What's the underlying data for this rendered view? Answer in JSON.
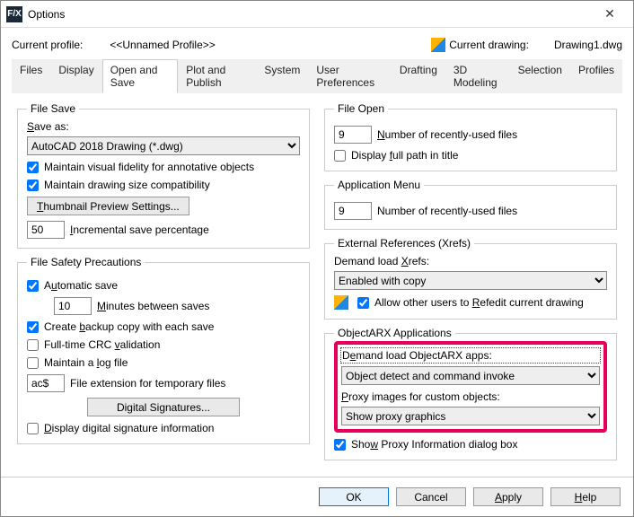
{
  "window": {
    "title": "Options"
  },
  "profile": {
    "label": "Current profile:",
    "value": "<<Unnamed Profile>>",
    "drawing_label": "Current drawing:",
    "drawing_value": "Drawing1.dwg"
  },
  "tabs": [
    "Files",
    "Display",
    "Open and Save",
    "Plot and Publish",
    "System",
    "User Preferences",
    "Drafting",
    "3D Modeling",
    "Selection",
    "Profiles"
  ],
  "active_tab": 2,
  "file_save": {
    "legend": "File Save",
    "save_as_label": "Save as:",
    "save_as_value": "AutoCAD 2018 Drawing (*.dwg)",
    "chk1": "Maintain visual fidelity for annotative objects",
    "chk2": "Maintain drawing size compatibility",
    "thumb_btn": "Thumbnail Preview Settings...",
    "inc_value": "50",
    "inc_label": "Incremental save percentage"
  },
  "safety": {
    "legend": "File Safety Precautions",
    "chk_auto": "Automatic save",
    "minutes_value": "10",
    "minutes_label": "Minutes between saves",
    "chk_backup": "Create backup copy with each save",
    "chk_crc": "Full-time CRC validation",
    "chk_log": "Maintain a log file",
    "ext_value": "ac$",
    "ext_label": "File extension for temporary files",
    "dig_btn": "Digital Signatures...",
    "chk_dsig": "Display digital signature information"
  },
  "file_open": {
    "legend": "File Open",
    "num_value": "9",
    "num_label": "Number of recently-used files",
    "chk_path": "Display full path in title"
  },
  "app_menu": {
    "legend": "Application Menu",
    "num_value": "9",
    "num_label": "Number of recently-used files"
  },
  "xrefs": {
    "legend": "External References (Xrefs)",
    "demand_label": "Demand load Xrefs:",
    "demand_value": "Enabled with copy",
    "chk_allow": "Allow other users to Refedit current drawing"
  },
  "arx": {
    "legend": "ObjectARX Applications",
    "demand_label": "Demand load ObjectARX apps:",
    "demand_value": "Object detect and command invoke",
    "proxy_label": "Proxy images for custom objects:",
    "proxy_value": "Show proxy graphics",
    "chk_show": "Show Proxy Information dialog box"
  },
  "buttons": {
    "ok": "OK",
    "cancel": "Cancel",
    "apply": "Apply",
    "help": "Help"
  }
}
